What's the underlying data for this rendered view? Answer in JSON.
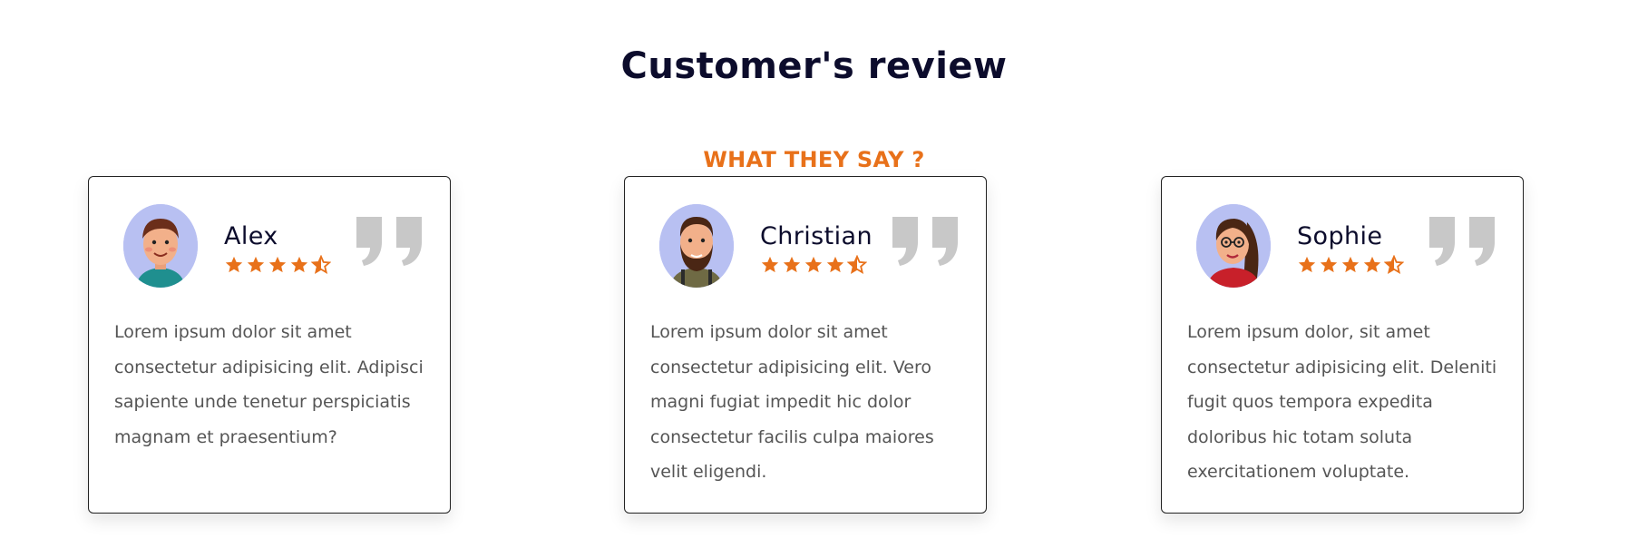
{
  "section": {
    "title": "Customer's review",
    "subtitle": "WHAT THEY SAY ?"
  },
  "colors": {
    "accent": "#e8711a",
    "title": "#0c0c2c",
    "text": "#555555",
    "quote": "#c8c8c8",
    "avatar_bg": "#b8c0f2"
  },
  "reviews": [
    {
      "name": "Alex",
      "avatar_icon": "man-avatar-icon",
      "rating": 4.5,
      "text": "Lorem ipsum dolor sit amet consectetur adipisicing elit. Adipisci sapiente unde tenetur perspiciatis magnam et praesentium?"
    },
    {
      "name": "Christian",
      "avatar_icon": "bearded-man-avatar-icon",
      "rating": 4.5,
      "text": "Lorem ipsum dolor sit amet consectetur adipisicing elit. Vero magni fugiat impedit hic dolor consectetur facilis culpa maiores velit eligendi."
    },
    {
      "name": "Sophie",
      "avatar_icon": "woman-avatar-icon",
      "rating": 4.5,
      "text": "Lorem ipsum dolor, sit amet consectetur adipisicing elit. Deleniti fugit quos tempora expedita doloribus hic totam soluta exercitationem voluptate."
    }
  ]
}
